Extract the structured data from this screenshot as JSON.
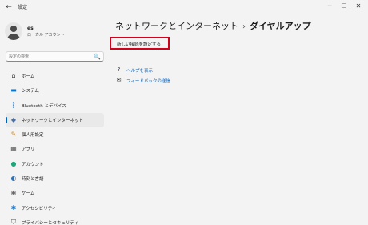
{
  "window": {
    "title": "設定",
    "back_glyph": "←",
    "minimize_glyph": "─",
    "maximize_glyph": "☐",
    "close_glyph": "✕"
  },
  "profile": {
    "name": "es",
    "account_type": "ローカル アカウント"
  },
  "search": {
    "placeholder": "設定の検索",
    "icon": "🔍"
  },
  "sidebar": {
    "items": [
      {
        "label": "ホーム",
        "icon": "home-icon",
        "glyph": "⌂",
        "color": "#444444"
      },
      {
        "label": "システム",
        "icon": "system-icon",
        "glyph": "▬",
        "color": "#0078d4"
      },
      {
        "label": "Bluetooth とデバイス",
        "icon": "bluetooth-icon",
        "glyph": "ᛒ",
        "color": "#0067c0"
      },
      {
        "label": "ネットワークとインターネット",
        "icon": "network-icon",
        "glyph": "◆",
        "color": "#4a6fa5",
        "active": true
      },
      {
        "label": "個人用設定",
        "icon": "personalization-icon",
        "glyph": "✎",
        "color": "#e08a1e"
      },
      {
        "label": "アプリ",
        "icon": "apps-icon",
        "glyph": "▦",
        "color": "#555555"
      },
      {
        "label": "アカウント",
        "icon": "accounts-icon",
        "glyph": "●",
        "color": "#1ea67a"
      },
      {
        "label": "時刻と言語",
        "icon": "time-language-icon",
        "glyph": "◐",
        "color": "#2f6fb7"
      },
      {
        "label": "ゲーム",
        "icon": "gaming-icon",
        "glyph": "◉",
        "color": "#666666"
      },
      {
        "label": "アクセシビリティ",
        "icon": "accessibility-icon",
        "glyph": "✱",
        "color": "#1a73c7"
      },
      {
        "label": "プライバシーとセキュリティ",
        "icon": "privacy-shield-icon",
        "glyph": "⛉",
        "color": "#555555"
      }
    ]
  },
  "main": {
    "breadcrumb_parent": "ネットワークとインターネット",
    "breadcrumb_sep": "›",
    "breadcrumb_current": "ダイヤルアップ",
    "setup_link": "新しい接続を設定する",
    "related": [
      {
        "label": "ヘルプを表示",
        "icon": "help-icon",
        "glyph": "?"
      },
      {
        "label": "フィードバックの送信",
        "icon": "feedback-icon",
        "glyph": "✉"
      }
    ]
  },
  "colors": {
    "accent": "#005fb8",
    "highlight_border": "#d0021b",
    "background": "#f3f3f3"
  }
}
